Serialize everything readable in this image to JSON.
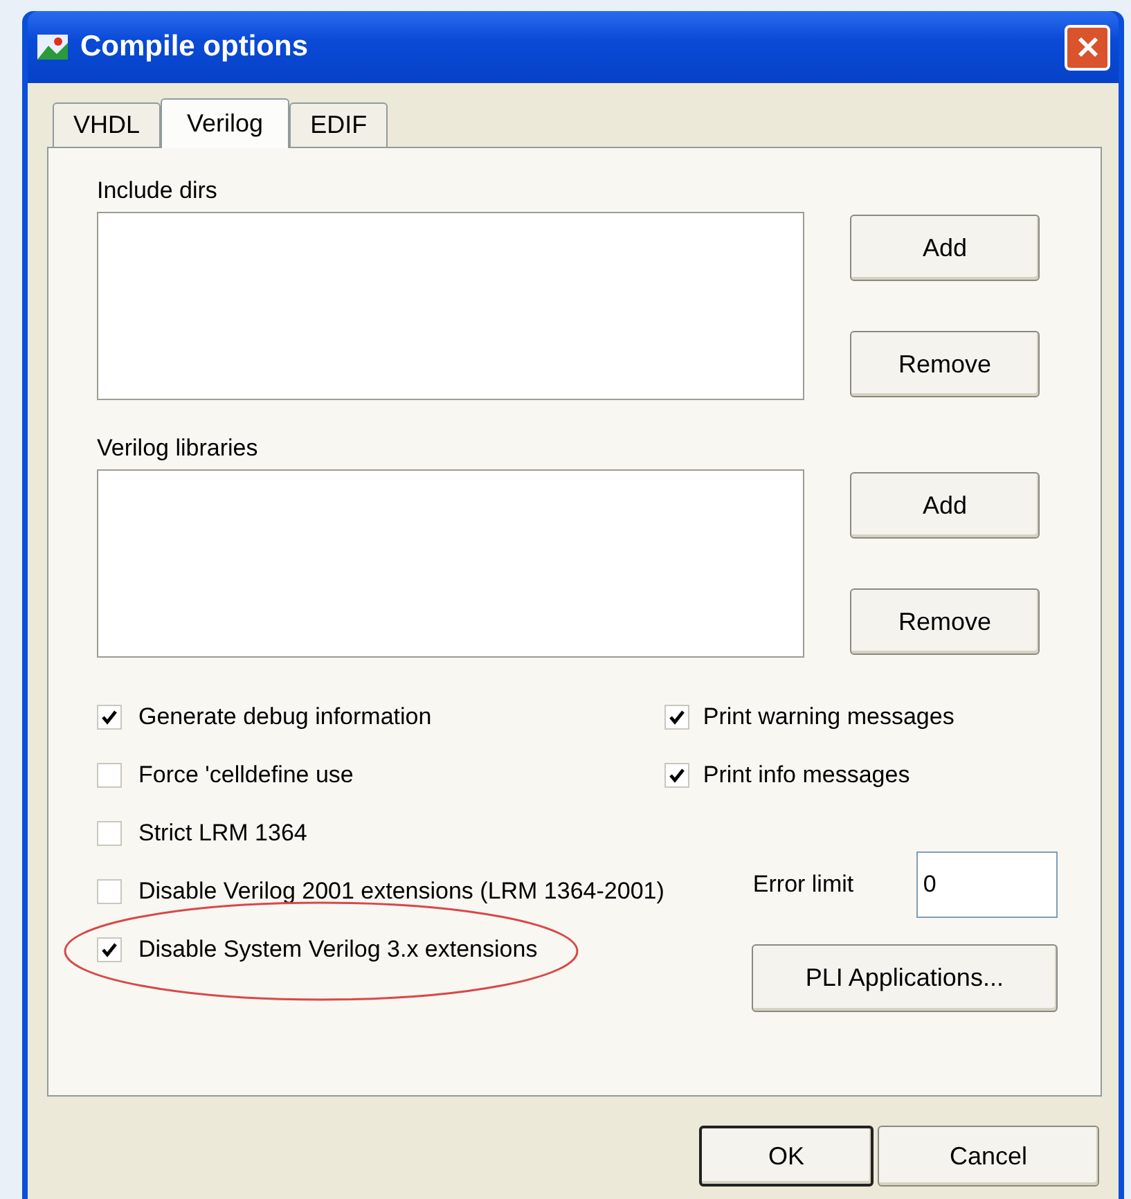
{
  "window": {
    "title": "Compile options"
  },
  "tabs": [
    {
      "label": "VHDL",
      "selected": false
    },
    {
      "label": "Verilog",
      "selected": true
    },
    {
      "label": "EDIF",
      "selected": false
    }
  ],
  "lists": [
    {
      "label": "Include dirs",
      "buttons": [
        "Add",
        "Remove"
      ]
    },
    {
      "label": "Verilog libraries",
      "buttons": [
        "Add",
        "Remove"
      ]
    }
  ],
  "left_options": [
    {
      "label": "Generate debug information",
      "checked": true,
      "highlighted": false
    },
    {
      "label": "Force 'celldefine use",
      "checked": false,
      "highlighted": false
    },
    {
      "label": "Strict LRM 1364",
      "checked": false,
      "highlighted": false
    },
    {
      "label": "Disable Verilog 2001 extensions (LRM 1364-2001)",
      "checked": false,
      "highlighted": false
    },
    {
      "label": "Disable System Verilog 3.x extensions",
      "checked": true,
      "highlighted": true
    }
  ],
  "right_options": [
    {
      "label": "Print warning messages",
      "checked": true
    },
    {
      "label": "Print info messages",
      "checked": true
    }
  ],
  "error_limit": {
    "label": "Error limit",
    "value": "0"
  },
  "pli_button": "PLI Applications...",
  "footer_buttons": [
    "OK",
    "Cancel"
  ]
}
